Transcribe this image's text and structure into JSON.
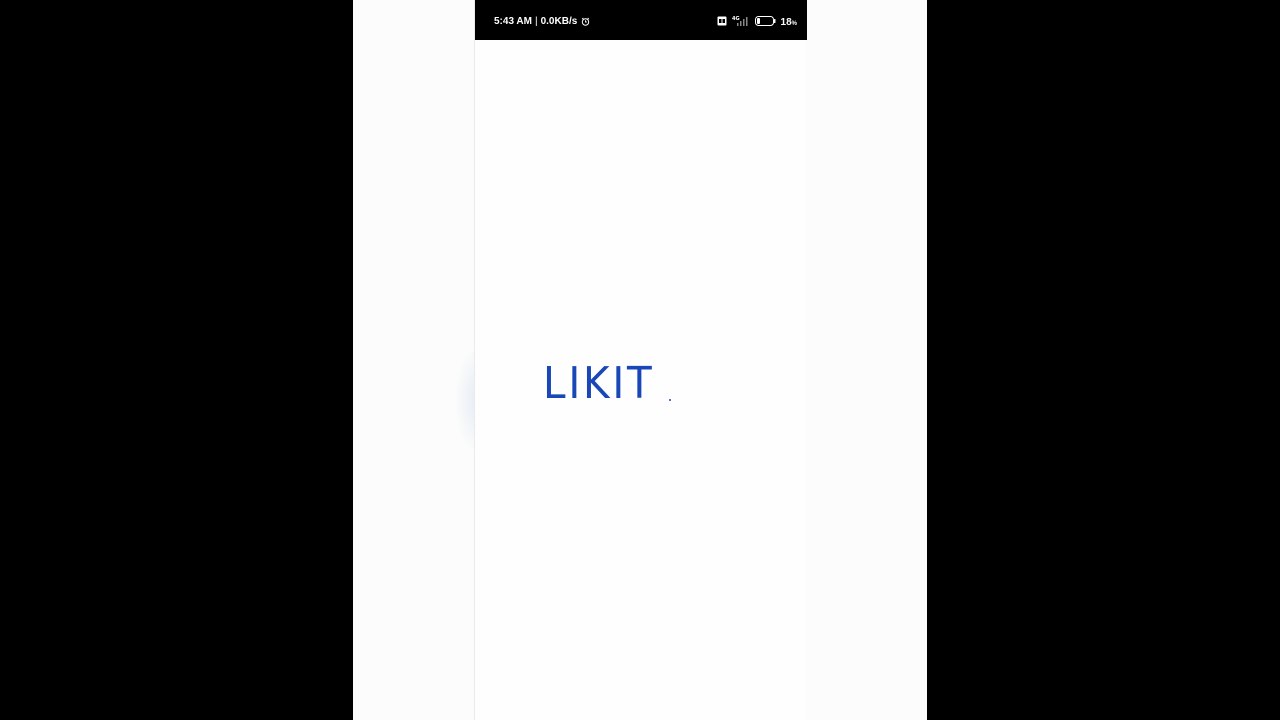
{
  "status_bar": {
    "time": "5:43 AM",
    "separator": "|",
    "network_speed": "0.0KB/s",
    "alarm_icon": "alarm-clock-icon",
    "sim_icon": "sim-card-icon",
    "network_type": "4G",
    "signal_icon": "cell-signal-icon",
    "battery_icon": "battery-icon",
    "battery_level": "18",
    "battery_unit": "%"
  },
  "splash": {
    "logo_text": "LIKIT",
    "logo_color": "#1a47b8"
  }
}
